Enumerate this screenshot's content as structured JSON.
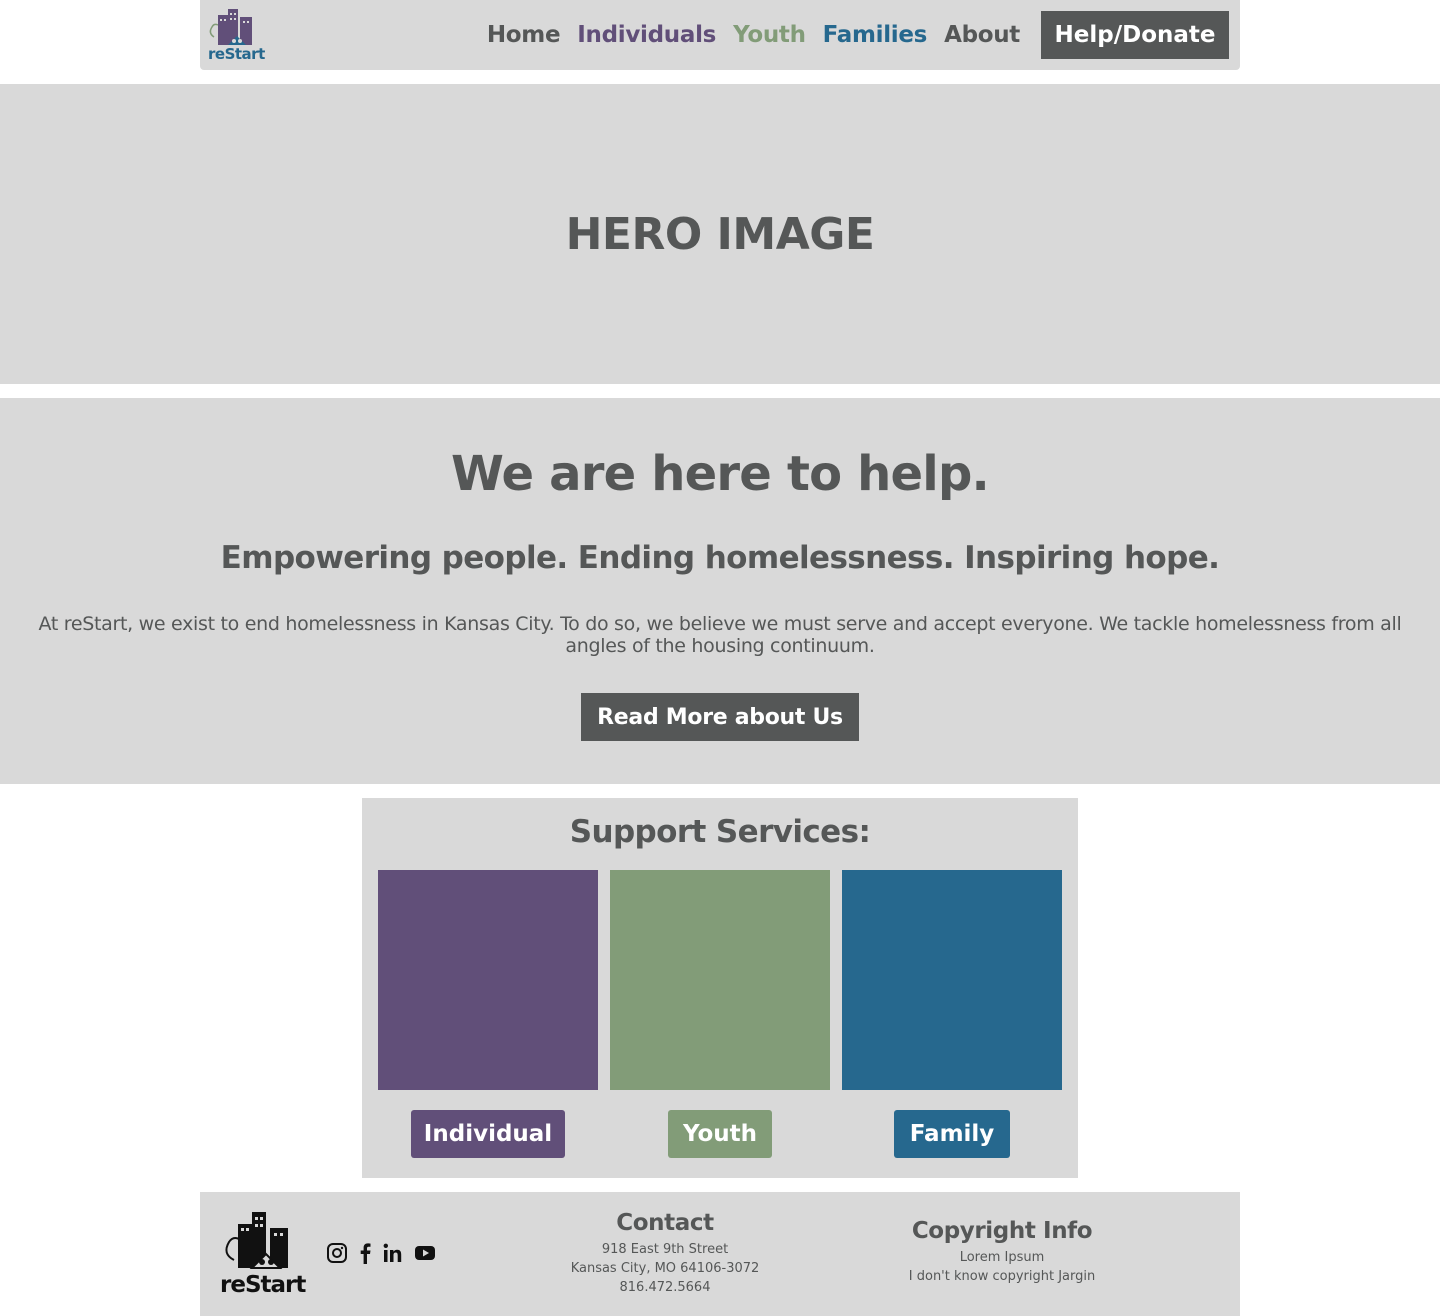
{
  "colors": {
    "gray_bg": "#d9d9d9",
    "dark": "#555757",
    "individuals": "#614f79",
    "youth": "#829c78",
    "families": "#26688e"
  },
  "nav": {
    "logo_text": "reStart",
    "links": [
      "Home",
      "Individuals",
      "Youth",
      "Families",
      "About"
    ],
    "donate_label": "Help/Donate"
  },
  "hero": {
    "label": "HERO IMAGE"
  },
  "intro": {
    "title": "We are here to help.",
    "subtitle": "Empowering people. Ending homelessness. Inspiring hope.",
    "body": "At reStart, we exist to end homelessness in Kansas City. To do so, we believe we must serve and accept everyone. We tackle homelessness from all angles of the housing continuum.",
    "button_label": "Read More about Us"
  },
  "services": {
    "title": "Support Services:",
    "items": [
      {
        "label": "Individual",
        "color": "#614f79"
      },
      {
        "label": "Youth",
        "color": "#829c78"
      },
      {
        "label": "Family",
        "color": "#26688e"
      }
    ]
  },
  "footer": {
    "logo_text": "reStart",
    "social_icons": [
      "instagram-icon",
      "facebook-icon",
      "linkedin-icon",
      "youtube-icon"
    ],
    "contact": {
      "heading": "Contact",
      "lines": [
        "918 East 9th Street",
        "Kansas City, MO 64106-3072",
        "816.472.5664"
      ]
    },
    "copyright": {
      "heading": "Copyright Info",
      "lines": [
        "Lorem Ipsum",
        "I don't know copyright Jargin"
      ]
    }
  }
}
